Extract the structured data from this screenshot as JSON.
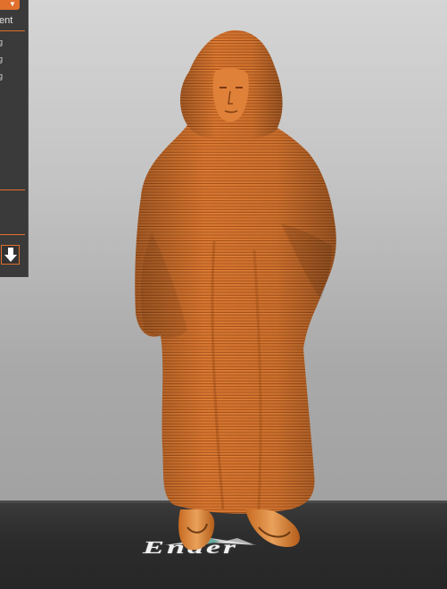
{
  "side_panel": {
    "header_text": "ent",
    "setting_glyphs": [
      "g",
      "g",
      "g"
    ],
    "download_icon": "download-arrow-icon",
    "accent_color": "#e0702c"
  },
  "viewport": {
    "plate_logo_text": "Ender",
    "model_color": "#d8752e",
    "background_top": "#d5d5d5",
    "background_bottom": "#9c9c9c",
    "plate_color": "#2d2d2d"
  }
}
